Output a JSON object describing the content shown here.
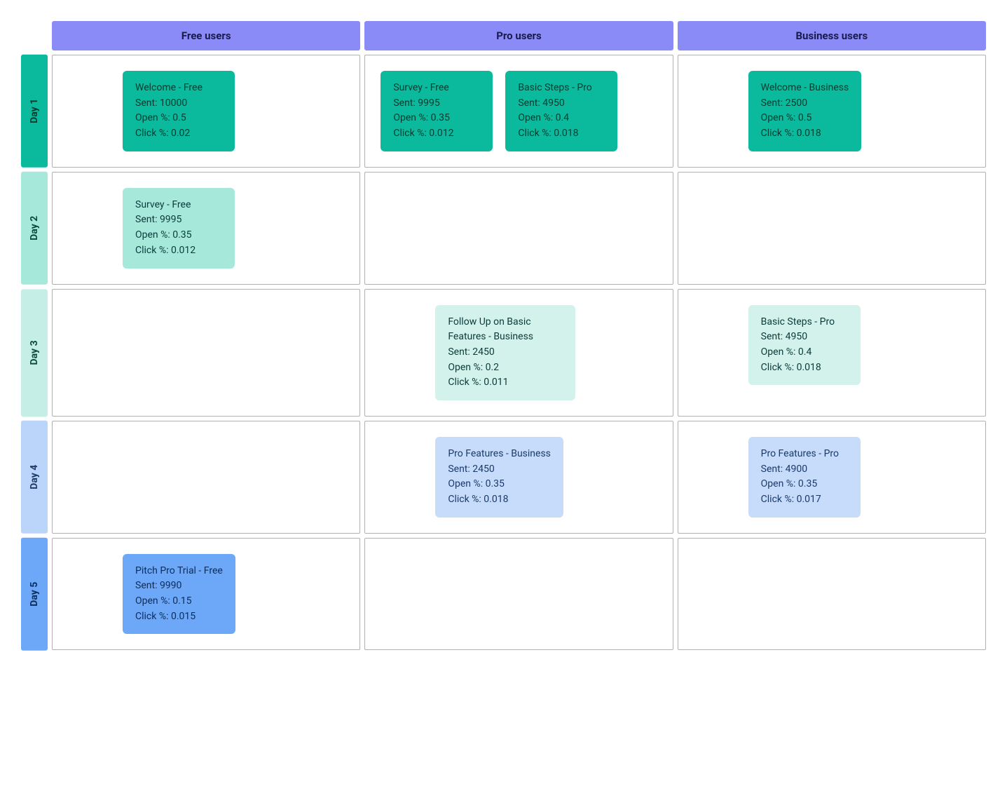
{
  "columns": [
    {
      "label": "Free users"
    },
    {
      "label": "Pro users"
    },
    {
      "label": "Business users"
    }
  ],
  "rows": [
    {
      "id": "day1",
      "label": "Day 1",
      "theme": "teal-strong",
      "cells": [
        {
          "indent": "indent-left",
          "cards": [
            {
              "theme": "teal-strong",
              "title": "Welcome - Free",
              "sent": "10000",
              "open": "0.5",
              "click": "0.02"
            }
          ]
        },
        {
          "cards": [
            {
              "theme": "teal-strong",
              "title": "Survey - Free",
              "sent": "9995",
              "open": "0.35",
              "click": "0.012"
            },
            {
              "theme": "teal-strong",
              "title": "Basic Steps - Pro",
              "sent": "4950",
              "open": "0.4",
              "click": "0.018"
            }
          ]
        },
        {
          "indent": "indent-mid",
          "cards": [
            {
              "theme": "teal-strong",
              "title": "Welcome - Business",
              "sent": "2500",
              "open": "0.5",
              "click": "0.018"
            }
          ]
        }
      ]
    },
    {
      "id": "day2",
      "label": "Day 2",
      "theme": "teal-light",
      "cells": [
        {
          "indent": "indent-left",
          "cards": [
            {
              "theme": "teal-light",
              "title": "Survey - Free",
              "sent": "9995",
              "open": "0.35",
              "click": "0.012"
            }
          ]
        },
        {
          "cards": []
        },
        {
          "cards": []
        }
      ]
    },
    {
      "id": "day3",
      "label": "Day 3",
      "theme": "teal-pale",
      "cells": [
        {
          "cards": []
        },
        {
          "indent": "indent-mid",
          "cards": [
            {
              "theme": "teal-pale",
              "title": "Follow Up on Basic Features - Business",
              "sent": "2450",
              "open": "0.2",
              "click": "0.011"
            }
          ]
        },
        {
          "indent": "indent-mid",
          "cards": [
            {
              "theme": "teal-pale",
              "title": "Basic Steps - Pro",
              "sent": "4950",
              "open": "0.4",
              "click": "0.018"
            }
          ]
        }
      ]
    },
    {
      "id": "day4",
      "label": "Day 4",
      "theme": "blue-light",
      "cells": [
        {
          "cards": []
        },
        {
          "indent": "indent-mid",
          "cards": [
            {
              "theme": "blue-light",
              "title": "Pro Features - Business",
              "sent": "2450",
              "open": "0.35",
              "click": "0.018"
            }
          ]
        },
        {
          "indent": "indent-mid",
          "cards": [
            {
              "theme": "blue-light",
              "title": "Pro Features - Pro",
              "sent": "4900",
              "open": "0.35",
              "click": "0.017"
            }
          ]
        }
      ]
    },
    {
      "id": "day5",
      "label": "Day 5",
      "theme": "blue-strong",
      "cells": [
        {
          "indent": "indent-left",
          "cards": [
            {
              "theme": "blue-strong",
              "title": "Pitch Pro Trial - Free",
              "sent": "9990",
              "open": "0.15",
              "click": "0.015"
            }
          ]
        },
        {
          "cards": []
        },
        {
          "cards": []
        }
      ]
    }
  ],
  "labels": {
    "sent": "Sent",
    "open": "Open %",
    "click": "Click %"
  }
}
